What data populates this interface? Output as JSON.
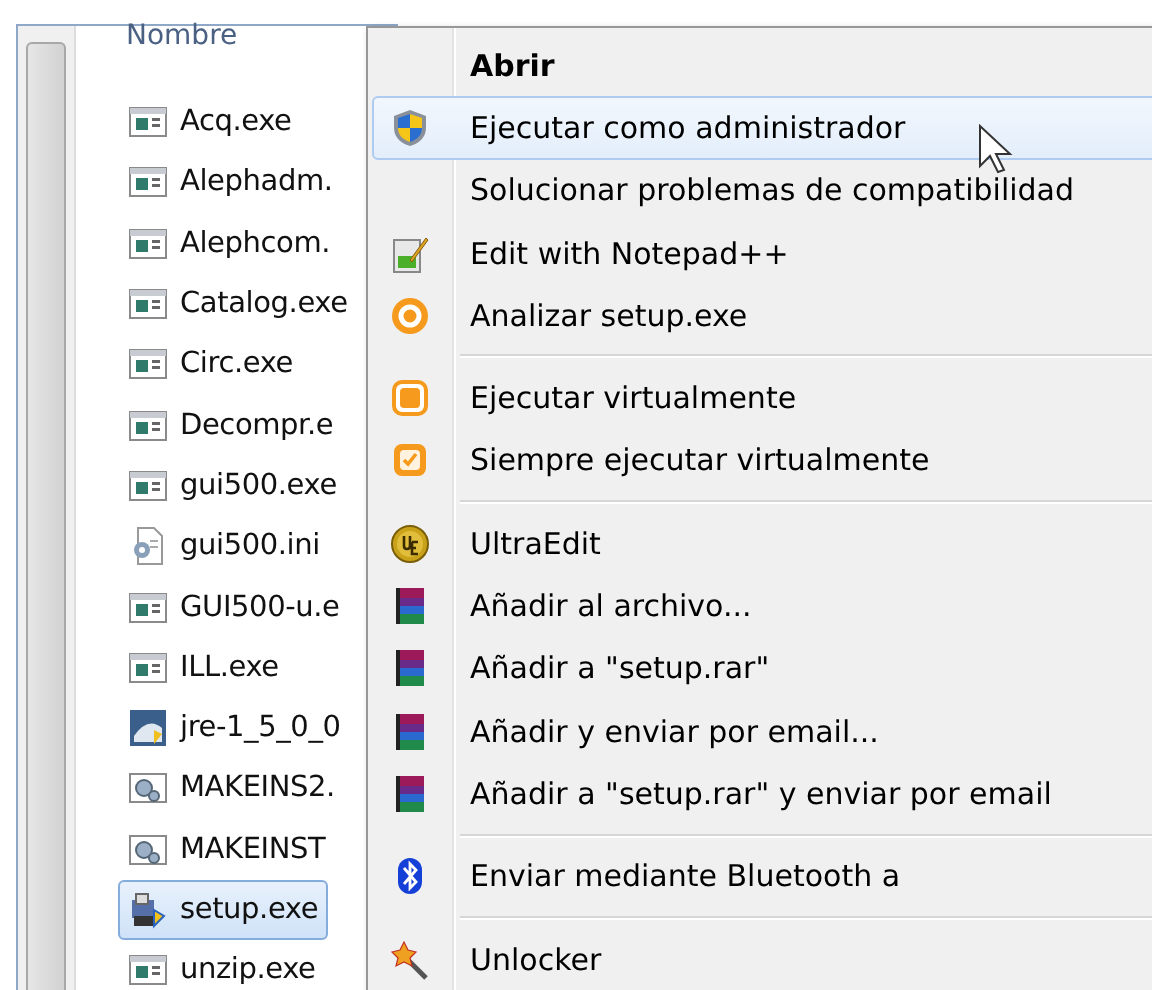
{
  "file_list": {
    "column_header": "Nombre",
    "files": [
      {
        "name": "Acq.exe",
        "kind": "app",
        "selected": false
      },
      {
        "name": "Alephadm.",
        "kind": "app",
        "selected": false
      },
      {
        "name": "Alephcom.",
        "kind": "app",
        "selected": false
      },
      {
        "name": "Catalog.exe",
        "kind": "app",
        "selected": false
      },
      {
        "name": "Circ.exe",
        "kind": "app",
        "selected": false
      },
      {
        "name": "Decompr.e",
        "kind": "app",
        "selected": false
      },
      {
        "name": "gui500.exe",
        "kind": "app",
        "selected": false
      },
      {
        "name": "gui500.ini",
        "kind": "settings",
        "selected": false
      },
      {
        "name": "GUI500-u.e",
        "kind": "app",
        "selected": false
      },
      {
        "name": "ILL.exe",
        "kind": "app",
        "selected": false
      },
      {
        "name": "jre-1_5_0_0",
        "kind": "java",
        "selected": false
      },
      {
        "name": "MAKEINS2.",
        "kind": "gears",
        "selected": false
      },
      {
        "name": "MAKEINST",
        "kind": "gears",
        "selected": false
      },
      {
        "name": "setup.exe",
        "kind": "installer",
        "selected": true
      },
      {
        "name": "unzip.exe",
        "kind": "app",
        "selected": false
      }
    ]
  },
  "context_menu": {
    "items": [
      {
        "kind": "plain",
        "label": "Abrir",
        "bold": true,
        "selected": false
      },
      {
        "kind": "shield",
        "label": "Ejecutar como administrador",
        "bold": false,
        "selected": true
      },
      {
        "kind": "plain",
        "label": "Solucionar problemas de compatibilidad",
        "bold": false,
        "selected": false
      },
      {
        "kind": "notepad",
        "label": "Edit with Notepad++",
        "bold": false,
        "selected": false
      },
      {
        "kind": "ring",
        "label": "Analizar setup.exe",
        "bold": false,
        "selected": false
      },
      {
        "kind": "separator"
      },
      {
        "kind": "square",
        "label": "Ejecutar virtualmente",
        "bold": false,
        "selected": false
      },
      {
        "kind": "check",
        "label": "Siempre ejecutar virtualmente",
        "bold": false,
        "selected": false
      },
      {
        "kind": "separator"
      },
      {
        "kind": "coin",
        "label": "UltraEdit",
        "bold": false,
        "selected": false
      },
      {
        "kind": "books",
        "label": "Añadir al archivo...",
        "bold": false,
        "selected": false
      },
      {
        "kind": "books",
        "label": "Añadir a \"setup.rar\"",
        "bold": false,
        "selected": false
      },
      {
        "kind": "books",
        "label": "Añadir y enviar por email...",
        "bold": false,
        "selected": false
      },
      {
        "kind": "books",
        "label": "Añadir a \"setup.rar\" y enviar por email",
        "bold": false,
        "selected": false
      },
      {
        "kind": "separator"
      },
      {
        "kind": "bluetooth",
        "label": "Enviar mediante Bluetooth a",
        "bold": false,
        "selected": false
      },
      {
        "kind": "separator"
      },
      {
        "kind": "wand",
        "label": "Unlocker",
        "bold": false,
        "selected": false
      }
    ]
  }
}
